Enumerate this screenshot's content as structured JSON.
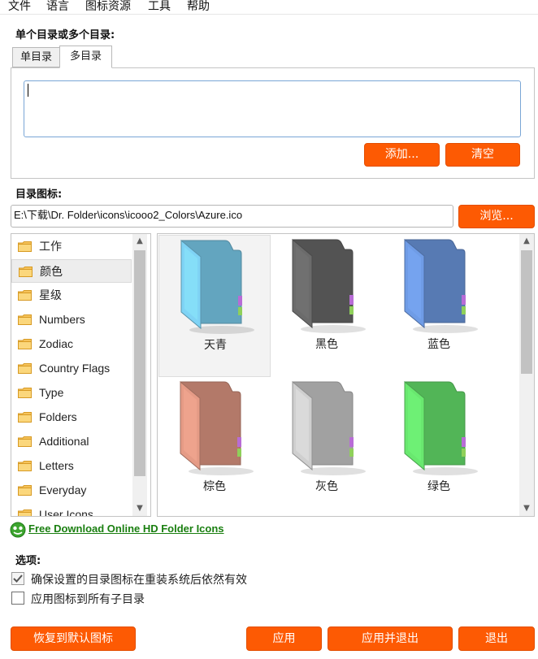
{
  "menu": [
    "文件",
    "语言",
    "图标资源",
    "工具",
    "帮助"
  ],
  "dir_section": {
    "label": "单个目录或多个目录:",
    "tabs": [
      "单目录",
      "多目录"
    ],
    "active_tab": "多目录",
    "textarea_value": "",
    "add_button": "添加...",
    "clear_button": "清空"
  },
  "icon_section": {
    "label": "目录图标:",
    "path_value": "E:\\下载\\Dr. Folder\\icons\\icooo2_Colors\\Azure.ico",
    "browse_button": "浏览..."
  },
  "categories": {
    "items": [
      "工作",
      "颜色",
      "星级",
      "Numbers",
      "Zodiac",
      "Country Flags",
      "Type",
      "Folders",
      "Additional",
      "Letters",
      "Everyday",
      "User Icons"
    ],
    "selected": "颜色"
  },
  "icons": {
    "items": [
      {
        "label": "天青",
        "color": "#7fd3f5",
        "selected": true
      },
      {
        "label": "黑色",
        "color": "#6b6b6b",
        "selected": false
      },
      {
        "label": "蓝色",
        "color": "#6f9ce6",
        "selected": false
      },
      {
        "label": "棕色",
        "color": "#e59b86",
        "selected": false
      },
      {
        "label": "灰色",
        "color": "#cfcfcf",
        "selected": false
      },
      {
        "label": "绿色",
        "color": "#69e86f",
        "selected": false
      }
    ]
  },
  "download_link": "Free Download Online HD Folder Icons",
  "options": {
    "label": "选项:",
    "items": [
      {
        "label": "确保设置的目录图标在重装系统后依然有效",
        "checked": true
      },
      {
        "label": "应用图标到所有子目录",
        "checked": false
      }
    ]
  },
  "footer": {
    "restore": "恢复到默认图标",
    "apply": "应用",
    "apply_exit": "应用并退出",
    "exit": "退出"
  },
  "accent_color": "#fd5a03"
}
